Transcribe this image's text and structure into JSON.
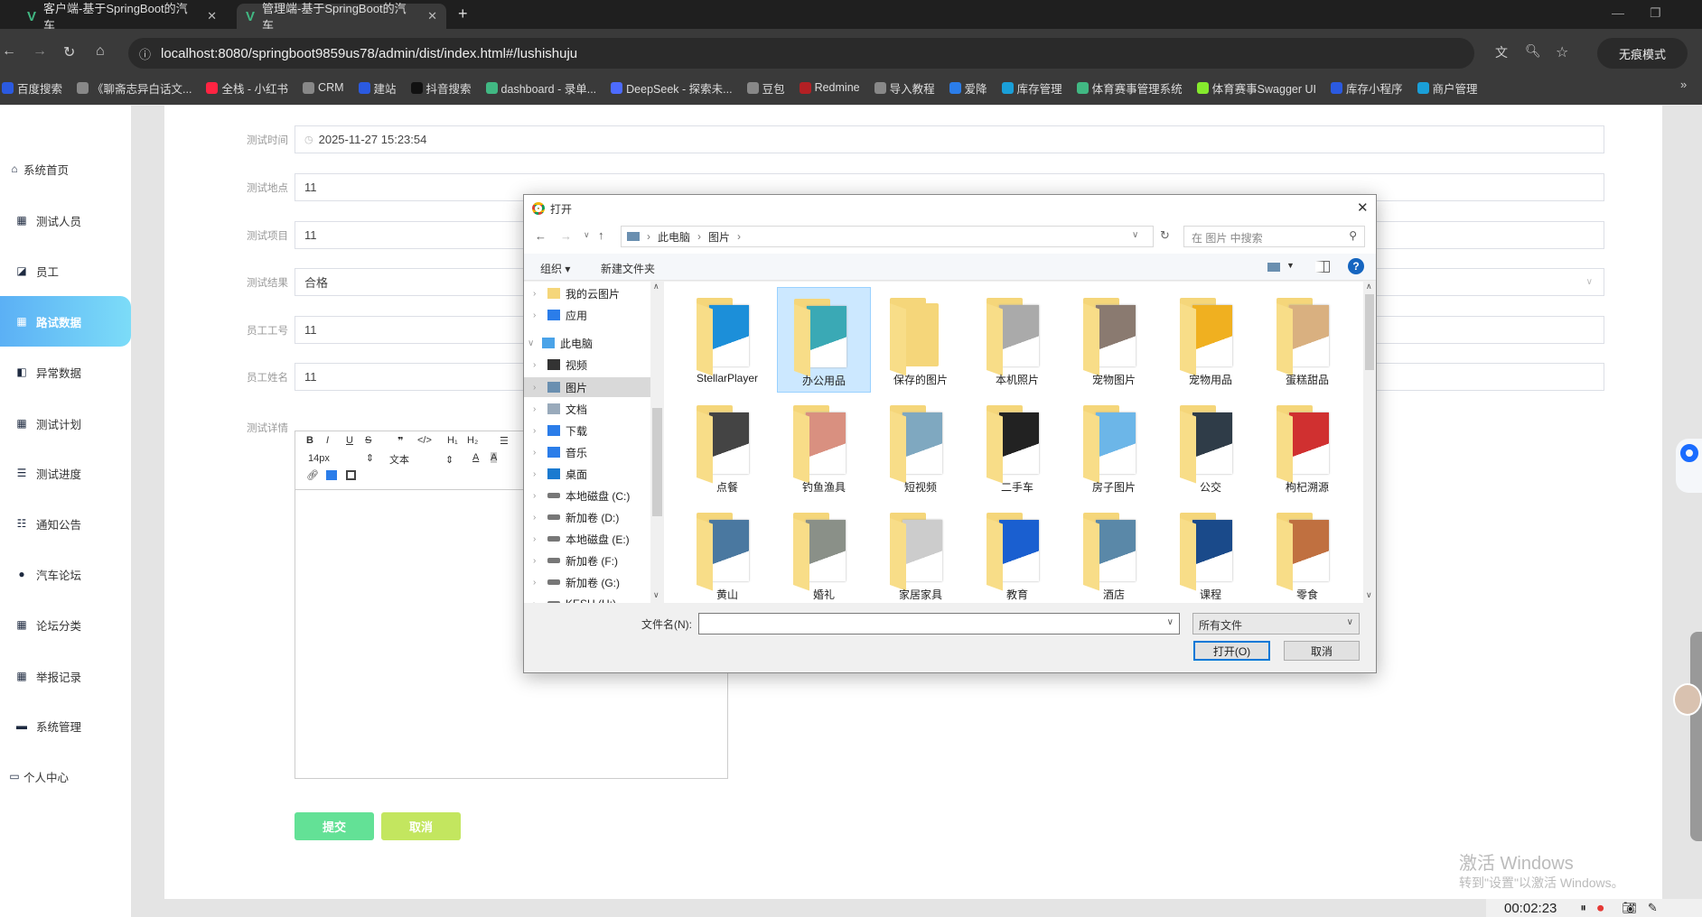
{
  "browser": {
    "tabs": [
      {
        "label": "客户端-基于SpringBoot的汽车",
        "active": false
      },
      {
        "label": "管理端-基于SpringBoot的汽车",
        "active": true
      }
    ],
    "url": "localhost:8080/springboot9859us78/admin/dist/index.html#/lushishuju",
    "incognito_label": "无痕模式",
    "bookmarks": [
      {
        "label": "百度搜索",
        "color": "#2b5ae0"
      },
      {
        "label": "《聊斋志异白话文...",
        "color": "#888"
      },
      {
        "label": "全栈 - 小红书",
        "color": "#ff2442"
      },
      {
        "label": "CRM",
        "color": "#888"
      },
      {
        "label": "建站",
        "color": "#2b5ae0"
      },
      {
        "label": "抖音搜索",
        "color": "#111"
      },
      {
        "label": "dashboard - 录单...",
        "color": "#41b883"
      },
      {
        "label": "DeepSeek - 探索未...",
        "color": "#4d6bfe"
      },
      {
        "label": "豆包",
        "color": "#888"
      },
      {
        "label": "Redmine",
        "color": "#b32024"
      },
      {
        "label": "导入教程",
        "color": "#888"
      },
      {
        "label": "爱降",
        "color": "#2b7de9"
      },
      {
        "label": "库存管理",
        "color": "#1a9fd8"
      },
      {
        "label": "体育赛事管理系统",
        "color": "#41b883"
      },
      {
        "label": "体育赛事Swagger UI",
        "color": "#85ea2d"
      },
      {
        "label": "库存小程序",
        "color": "#2b5ae0"
      },
      {
        "label": "商户管理",
        "color": "#1a9fd8"
      }
    ]
  },
  "sidebar": {
    "items": [
      {
        "label": "系统首页",
        "icon": "home-icon"
      },
      {
        "label": "测试人员",
        "icon": "grid-icon"
      },
      {
        "label": "员工",
        "icon": "chart-icon"
      },
      {
        "label": "路试数据",
        "icon": "grid-icon",
        "active": true
      },
      {
        "label": "异常数据",
        "icon": "wallet-icon"
      },
      {
        "label": "测试计划",
        "icon": "grid-icon"
      },
      {
        "label": "测试进度",
        "icon": "list-icon"
      },
      {
        "label": "通知公告",
        "icon": "sliders-icon"
      },
      {
        "label": "汽车论坛",
        "icon": "user-icon"
      },
      {
        "label": "论坛分类",
        "icon": "grid-icon"
      },
      {
        "label": "举报记录",
        "icon": "grid-icon"
      },
      {
        "label": "系统管理",
        "icon": "monitor-icon"
      },
      {
        "label": "个人中心",
        "icon": "card-icon"
      }
    ]
  },
  "form": {
    "fields": [
      {
        "label": "测试时间",
        "value": "2025-11-27 15:23:54"
      },
      {
        "label": "测试地点",
        "value": "11"
      },
      {
        "label": "测试项目",
        "value": "11"
      },
      {
        "label": "测试结果",
        "value": "合格"
      },
      {
        "label": "员工工号",
        "value": "11"
      },
      {
        "label": "员工姓名",
        "value": "11"
      }
    ],
    "detail_label": "测试详情",
    "editor": {
      "font_size": "14px",
      "format": "文本"
    },
    "submit": "提交",
    "cancel": "取消",
    "accent_submit": "#63e196",
    "accent_cancel": "#c3e65f"
  },
  "dialog": {
    "title": "打开",
    "breadcrumb": [
      "此电脑",
      "图片"
    ],
    "search_placeholder": "在 图片 中搜索",
    "organize": "组织 ▾",
    "new_folder": "新建文件夹",
    "tree": [
      {
        "label": "我的云图片",
        "indent": 1
      },
      {
        "label": "应用",
        "indent": 1
      },
      {
        "label": "此电脑",
        "indent": 0,
        "expanded": true
      },
      {
        "label": "视频",
        "indent": 1
      },
      {
        "label": "图片",
        "indent": 1,
        "selected": true
      },
      {
        "label": "文档",
        "indent": 1
      },
      {
        "label": "下载",
        "indent": 1
      },
      {
        "label": "音乐",
        "indent": 1
      },
      {
        "label": "桌面",
        "indent": 1
      },
      {
        "label": "本地磁盘 (C:)",
        "indent": 1
      },
      {
        "label": "新加卷 (D:)",
        "indent": 1
      },
      {
        "label": "本地磁盘 (E:)",
        "indent": 1
      },
      {
        "label": "新加卷 (F:)",
        "indent": 1
      },
      {
        "label": "新加卷 (G:)",
        "indent": 1
      },
      {
        "label": "KESU (H:)",
        "indent": 1
      }
    ],
    "folders": [
      {
        "name": "StellarPlayer",
        "thumb": "#1c8fd9"
      },
      {
        "name": "办公用品",
        "thumb": "#3aa9b5",
        "selected": true
      },
      {
        "name": "保存的图片",
        "thumb": ""
      },
      {
        "name": "本机照片",
        "thumb": "#aaaaaa"
      },
      {
        "name": "宠物图片",
        "thumb": "#8a7a70"
      },
      {
        "name": "宠物用品",
        "thumb": "#f0b020"
      },
      {
        "name": "蛋糕甜品",
        "thumb": "#d9b080"
      },
      {
        "name": "点餐",
        "thumb": "#444444"
      },
      {
        "name": "钓鱼渔具",
        "thumb": "#d99080"
      },
      {
        "name": "短视频",
        "thumb": "#7fa8c0"
      },
      {
        "name": "二手车",
        "thumb": "#222222"
      },
      {
        "name": "房子图片",
        "thumb": "#6cb6e8"
      },
      {
        "name": "公交",
        "thumb": "#2f3c48"
      },
      {
        "name": "枸杞溯源",
        "thumb": "#d03030"
      },
      {
        "name": "黄山",
        "thumb": "#4a78a0"
      },
      {
        "name": "婚礼",
        "thumb": "#8a9088"
      },
      {
        "name": "家居家具",
        "thumb": "#cccccc"
      },
      {
        "name": "教育",
        "thumb": "#1a5fd0"
      },
      {
        "name": "酒店",
        "thumb": "#5a88a8"
      },
      {
        "name": "课程",
        "thumb": "#1a4a8a"
      },
      {
        "name": "零食",
        "thumb": "#c07040"
      }
    ],
    "filename_label": "文件名(N):",
    "filename_value": "",
    "filter": "所有文件",
    "open": "打开(O)",
    "cancel": "取消"
  },
  "overlay": {
    "watermark_title": "激活 Windows",
    "watermark_sub": "转到\"设置\"以激活 Windows。",
    "timer": "00:02:23"
  }
}
